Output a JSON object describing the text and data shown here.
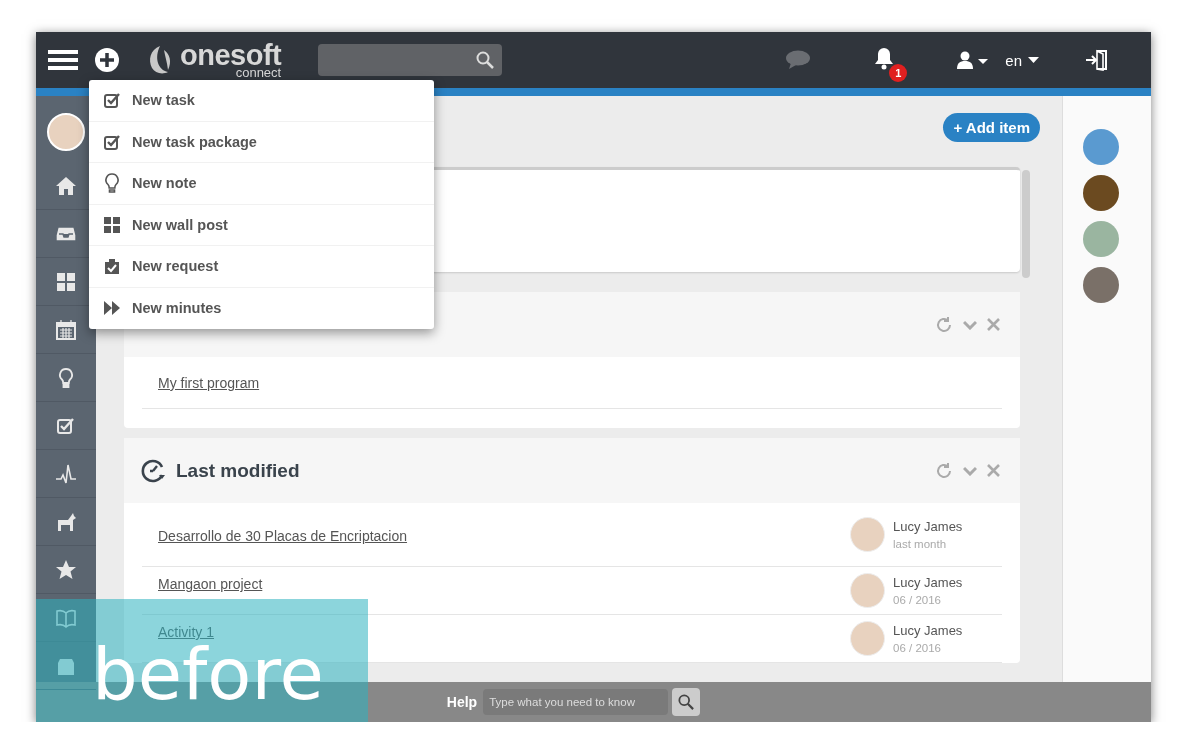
{
  "topbar": {
    "logo_text": "onesoft",
    "logo_subtext": "connect",
    "notification_count": "1",
    "language": "en"
  },
  "new_menu": {
    "items": [
      {
        "kind": "task",
        "label": "New task"
      },
      {
        "kind": "task",
        "label": "New task package"
      },
      {
        "kind": "note",
        "label": "New note"
      },
      {
        "kind": "wall",
        "label": "New wall post"
      },
      {
        "kind": "request",
        "label": "New request"
      },
      {
        "kind": "minutes",
        "label": "New minutes"
      }
    ]
  },
  "toolbar": {
    "add_button": "+ Add item"
  },
  "program_widget": {
    "items": [
      "My first program"
    ]
  },
  "last_modified": {
    "title": "Last modified",
    "rows": [
      {
        "title": "Desarrollo de 30 Placas de Encriptacion",
        "user": "Lucy James",
        "when": "last month"
      },
      {
        "title": "Mangaon project",
        "user": "Lucy James",
        "when": "06 / 2016"
      },
      {
        "title": "Activity 1",
        "user": "Lucy James",
        "when": "06 / 2016"
      }
    ]
  },
  "help_bar": {
    "label": "Help",
    "placeholder": "Type what you need to know"
  },
  "overlay_label": "before"
}
